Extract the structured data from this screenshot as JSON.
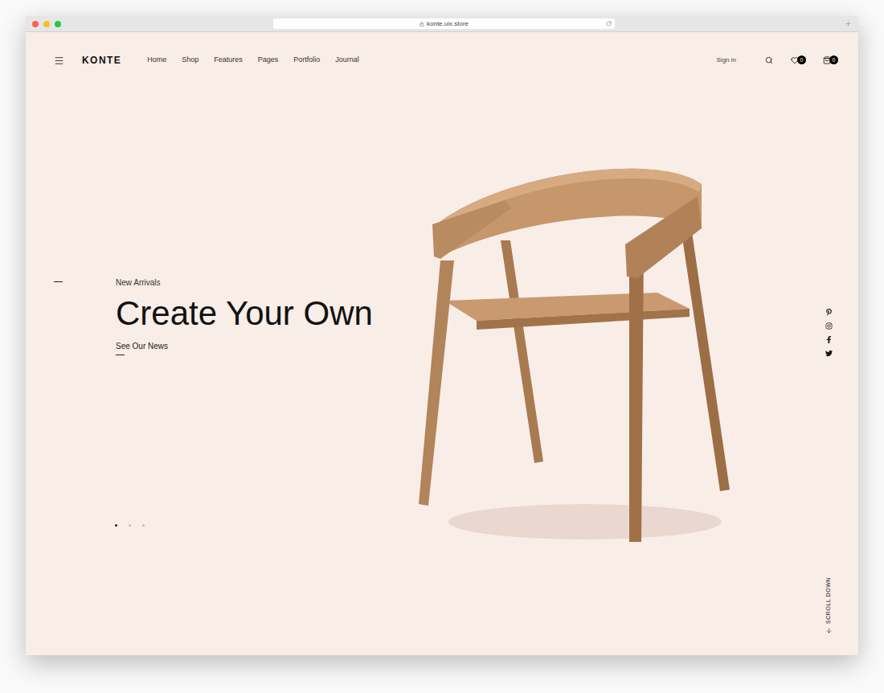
{
  "browser": {
    "url": "konte.uix.store"
  },
  "header": {
    "logo": "KONTE",
    "nav": [
      {
        "label": "Home"
      },
      {
        "label": "Shop"
      },
      {
        "label": "Features"
      },
      {
        "label": "Pages"
      },
      {
        "label": "Portfolio"
      },
      {
        "label": "Journal"
      }
    ],
    "sign_in": "Sign in",
    "wishlist_count": "0",
    "cart_count": "0"
  },
  "hero": {
    "eyebrow": "New Arrivals",
    "title": "Create Your Own",
    "link": "See Our News",
    "slides": [
      {
        "selected": true
      },
      {
        "selected": false
      },
      {
        "selected": false
      }
    ]
  },
  "social": [
    {
      "network": "pinterest"
    },
    {
      "network": "instagram"
    },
    {
      "network": "facebook"
    },
    {
      "network": "twitter"
    }
  ],
  "scroll_hint": "SCROLL DOWN"
}
